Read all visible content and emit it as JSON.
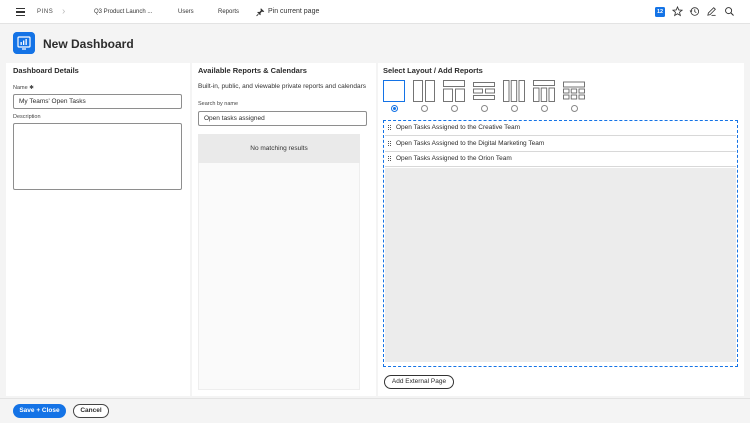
{
  "topbar": {
    "pins_label": "PINS",
    "project_label": "Q3 Product Launch ...",
    "users_label": "Users",
    "reports_label": "Reports",
    "pin_page_label": "Pin current page",
    "notifications_count": "12",
    "accent_color": "#1473e6",
    "icons": [
      "menu-icon",
      "chevron-right-icon",
      "pin-icon",
      "star-icon",
      "history-icon",
      "edit-icon",
      "search-icon"
    ]
  },
  "header": {
    "title": "New Dashboard",
    "icon": "dashboard-icon"
  },
  "details": {
    "title": "Dashboard Details",
    "name_label": "Name",
    "required_mark": "✱",
    "name_value": "My Teams' Open Tasks",
    "description_label": "Description",
    "description_value": ""
  },
  "available": {
    "title": "Available Reports & Calendars",
    "subtitle": "Built-in, public, and viewable private reports and calendars",
    "search_label": "Search by name",
    "search_value": "Open tasks assigned",
    "no_results": "No matching results"
  },
  "layout": {
    "title": "Select Layout / Add Reports",
    "options": [
      "single",
      "two-columns",
      "top-two-columns",
      "rows",
      "three-columns",
      "top-three-columns",
      "grid"
    ],
    "selected_index": 0,
    "reports": [
      "Open Tasks Assigned to the Creative Team",
      "Open Tasks Assigned to the Digital Marketing Team",
      "Open Tasks Assigned to the Orion Team"
    ],
    "add_external_label": "Add External Page"
  },
  "footer": {
    "save_label": "Save + Close",
    "cancel_label": "Cancel"
  }
}
